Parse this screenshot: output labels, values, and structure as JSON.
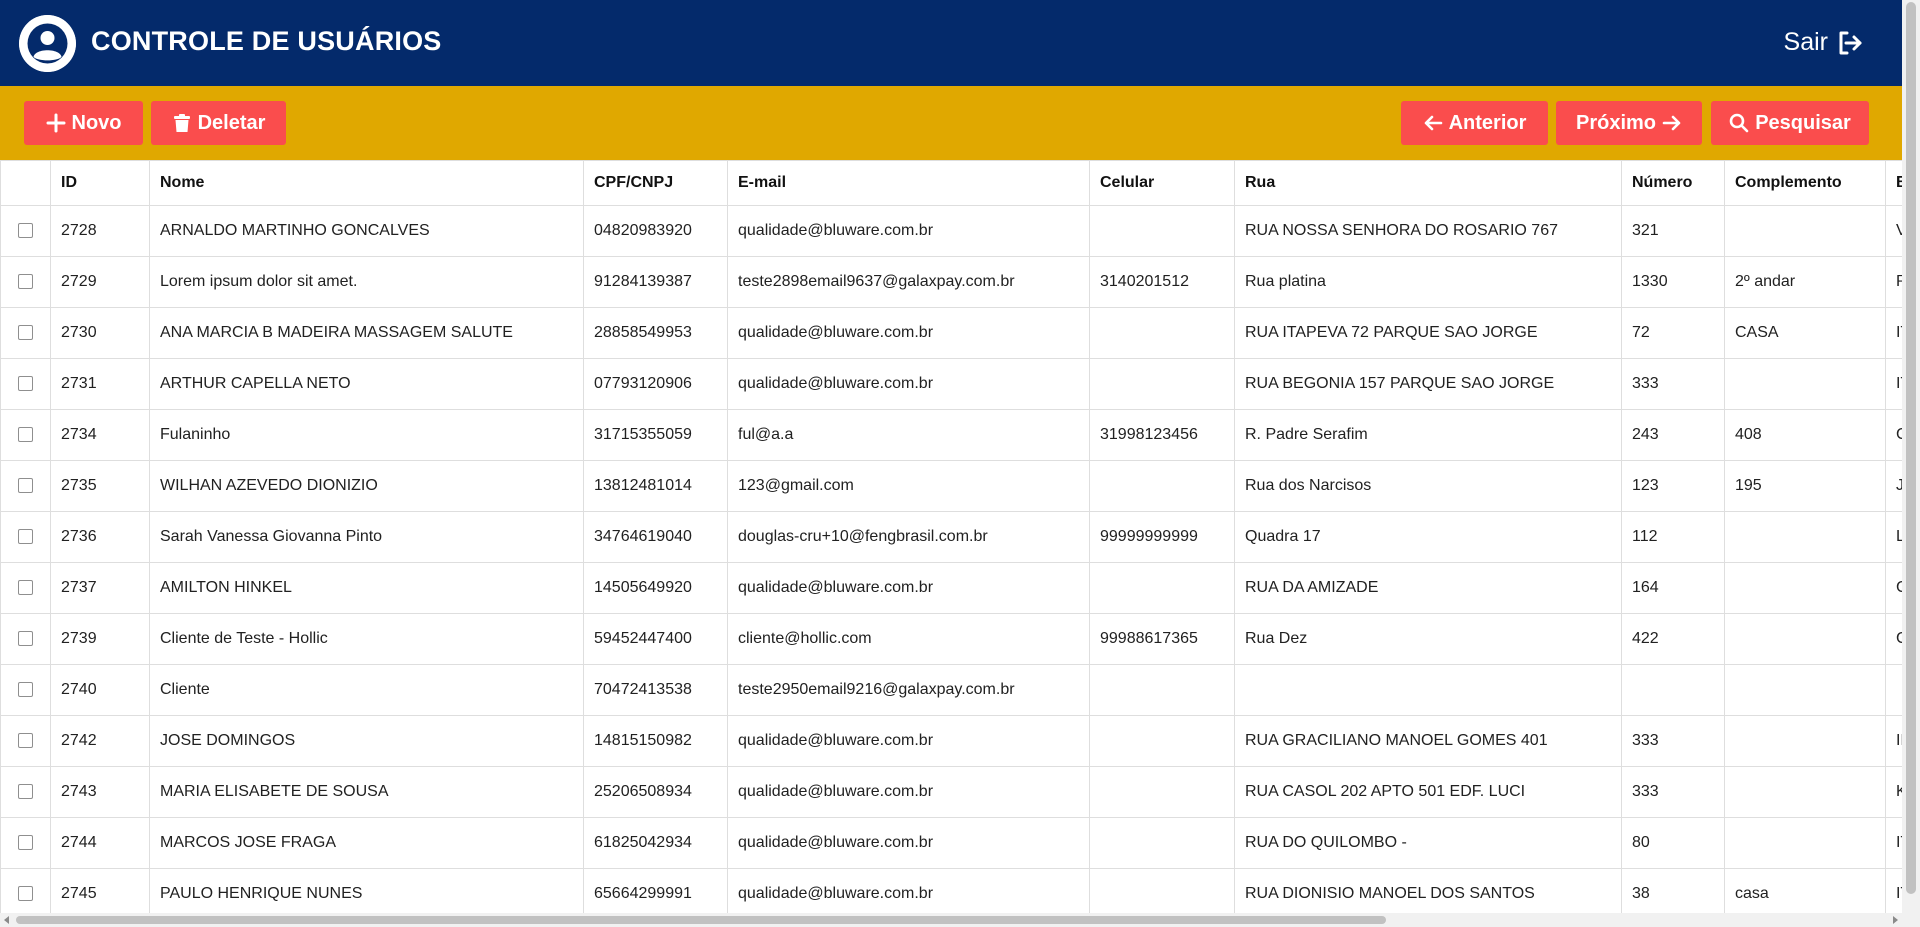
{
  "header": {
    "title": "CONTROLE DE USUÁRIOS",
    "logout_label": "Sair",
    "background": "#042a6b"
  },
  "toolbar": {
    "background": "#e0a800",
    "button_color": "#fa4d4d",
    "new_label": "Novo",
    "delete_label": "Deletar",
    "prev_label": "Anterior",
    "next_label": "Próximo",
    "search_label": "Pesquisar"
  },
  "table": {
    "columns": [
      "ID",
      "Nome",
      "CPF/CNPJ",
      "E-mail",
      "Celular",
      "Rua",
      "Número",
      "Complemento",
      "B"
    ],
    "rows": [
      [
        "2728",
        "ARNALDO MARTINHO GONCALVES",
        "04820983920",
        "qualidade@bluware.com.br",
        "",
        "RUA NOSSA SENHORA DO ROSARIO 767",
        "321",
        "",
        "V"
      ],
      [
        "2729",
        "Lorem ipsum dolor sit amet.",
        "91284139387",
        "teste2898email9637@galaxpay.com.br",
        "3140201512",
        "Rua platina",
        "1330",
        "2º andar",
        "P"
      ],
      [
        "2730",
        "ANA MARCIA B MADEIRA MASSAGEM SALUTE",
        "28858549953",
        "qualidade@bluware.com.br",
        "",
        "RUA ITAPEVA 72 PARQUE SAO JORGE",
        "72",
        "CASA",
        "IT"
      ],
      [
        "2731",
        "ARTHUR CAPELLA NETO",
        "07793120906",
        "qualidade@bluware.com.br",
        "",
        "RUA BEGONIA 157 PARQUE SAO JORGE",
        "333",
        "",
        "IT"
      ],
      [
        "2734",
        "Fulaninho",
        "31715355059",
        "ful@a.a",
        "31998123456",
        "R. Padre Serafim",
        "243",
        "408",
        "C"
      ],
      [
        "2735",
        "WILHAN AZEVEDO DIONIZIO",
        "13812481014",
        "123@gmail.com",
        "",
        "Rua dos Narcisos",
        "123",
        "195",
        "JA"
      ],
      [
        "2736",
        "Sarah Vanessa Giovanna Pinto",
        "34764619040",
        "douglas-cru+10@fengbrasil.com.br",
        "99999999999",
        "Quadra 17",
        "112",
        "",
        "Lo"
      ],
      [
        "2737",
        "AMILTON HINKEL",
        "14505649920",
        "qualidade@bluware.com.br",
        "",
        "RUA DA AMIZADE",
        "164",
        "",
        "C"
      ],
      [
        "2739",
        "Cliente de Teste - Hollic",
        "59452447400",
        "cliente@hollic.com",
        "99988617365",
        "Rua Dez",
        "422",
        "",
        "C"
      ],
      [
        "2740",
        "Cliente",
        "70472413538",
        "teste2950email9216@galaxpay.com.br",
        "",
        "",
        "",
        "",
        ""
      ],
      [
        "2742",
        "JOSE DOMINGOS",
        "14815150982",
        "qualidade@bluware.com.br",
        "",
        "RUA GRACILIANO MANOEL GOMES 401",
        "333",
        "",
        "IN"
      ],
      [
        "2743",
        "MARIA ELISABETE DE SOUSA",
        "25206508934",
        "qualidade@bluware.com.br",
        "",
        "RUA CASOL 202 APTO 501 EDF. LUCI",
        "333",
        "",
        "K"
      ],
      [
        "2744",
        "MARCOS JOSE FRAGA",
        "61825042934",
        "qualidade@bluware.com.br",
        "",
        "RUA DO QUILOMBO -",
        "80",
        "",
        "IT"
      ],
      [
        "2745",
        "PAULO HENRIQUE NUNES",
        "65664299991",
        "qualidade@bluware.com.br",
        "",
        "RUA DIONISIO MANOEL DOS SANTOS",
        "38",
        "casa",
        "IT"
      ]
    ]
  }
}
